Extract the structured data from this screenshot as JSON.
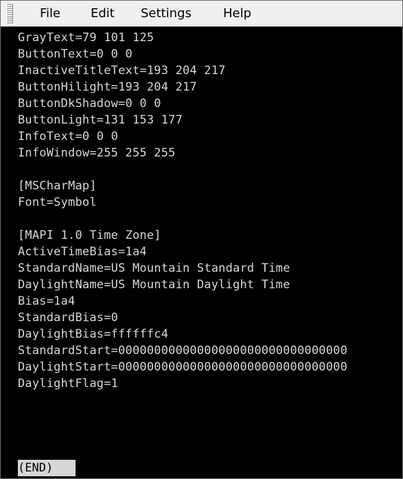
{
  "menubar": {
    "items": [
      "File",
      "Edit",
      "Settings",
      "Help"
    ]
  },
  "terminal": {
    "lines": [
      "GrayText=79 101 125",
      "ButtonText=0 0 0",
      "InactiveTitleText=193 204 217",
      "ButtonHilight=193 204 217",
      "ButtonDkShadow=0 0 0",
      "ButtonLight=131 153 177",
      "InfoText=0 0 0",
      "InfoWindow=255 255 255",
      "",
      "[MSCharMap]",
      "Font=Symbol",
      "",
      "[MAPI 1.0 Time Zone]",
      "ActiveTimeBias=1a4",
      "StandardName=US Mountain Standard Time",
      "DaylightName=US Mountain Daylight Time",
      "Bias=1a4",
      "StandardBias=0",
      "DaylightBias=ffffffc4",
      "StandardStart=00000000000000000000000000000000",
      "DaylightStart=00000000000000000000000000000000",
      "DaylightFlag=1"
    ],
    "prompt": "(END)"
  }
}
